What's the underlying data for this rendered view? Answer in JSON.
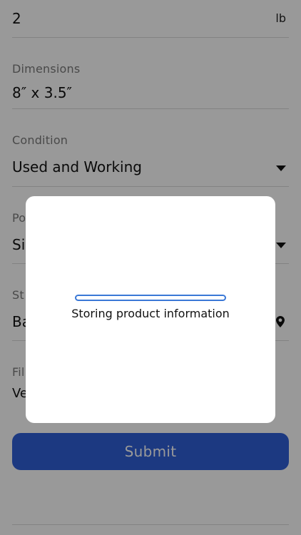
{
  "weight": {
    "value": "2",
    "unit": "lb"
  },
  "dimensions": {
    "label": "Dimensions",
    "value": "8″ x 3.5″"
  },
  "condition": {
    "label": "Condition",
    "value": "Used and Working"
  },
  "field4": {
    "label": "Po",
    "value": "Si"
  },
  "field5": {
    "label": "St",
    "value": "Ba"
  },
  "field6": {
    "label": "Fil",
    "value": "Ve"
  },
  "submit_label": "Submit",
  "dialog": {
    "message": "Storing product information",
    "progress": 0
  },
  "colors": {
    "primary": "#2f5fd8",
    "progress": "#3a78d6",
    "overlay": "rgba(0,0,0,0.40)"
  },
  "icons": {
    "dropdown": "caret-down-icon",
    "location": "location-pin-icon"
  }
}
